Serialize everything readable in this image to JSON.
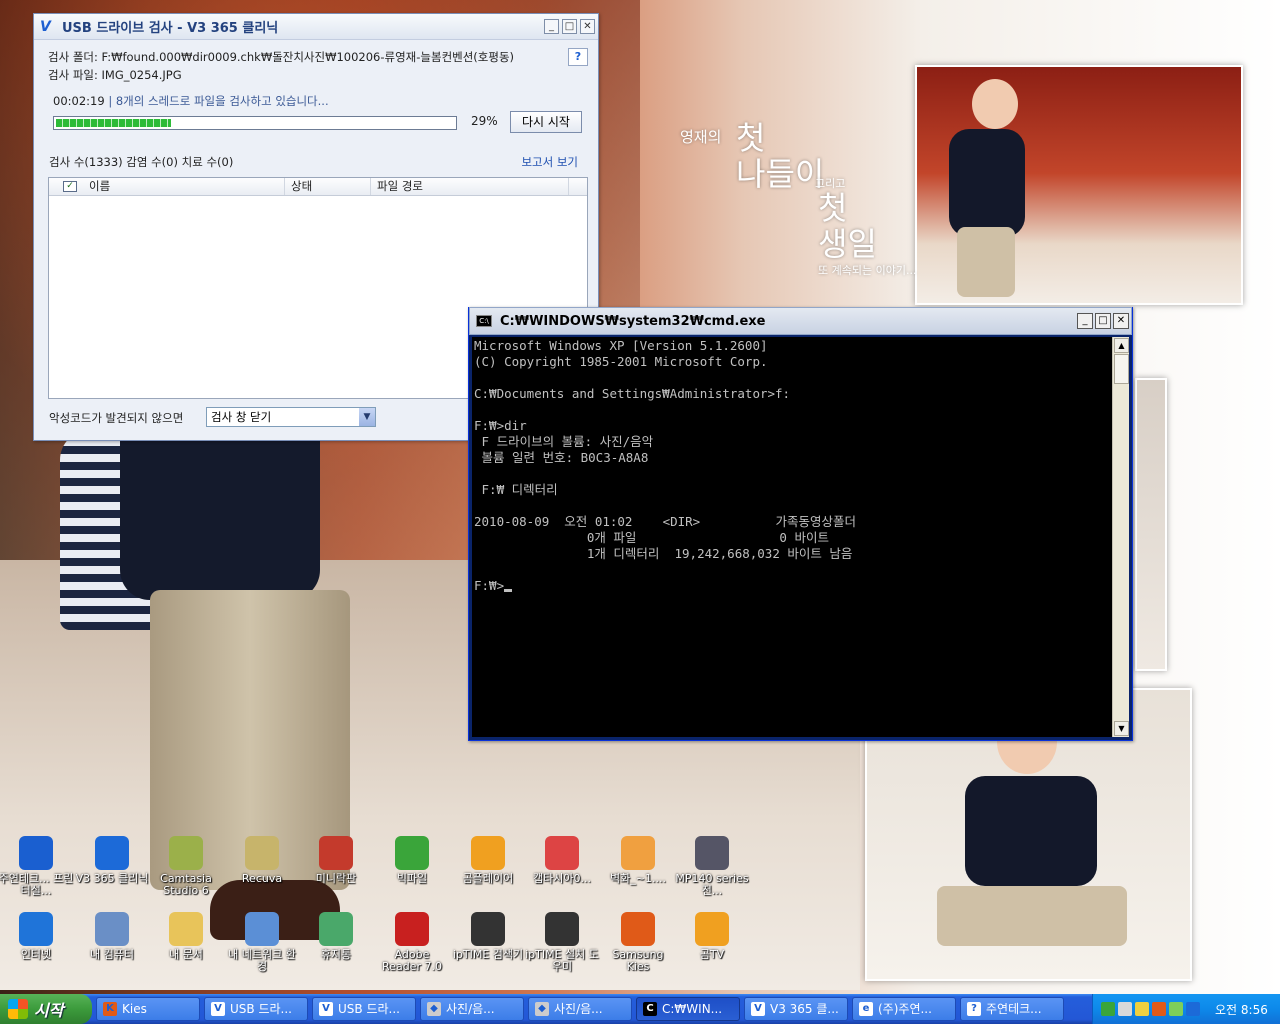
{
  "v3": {
    "title": "USB 드라이브 검사 - V3 365 클리닉",
    "folder_line": "검사 폴더: F:₩found.000₩dir0009.chk₩돌잔치사진₩100206-류영재-늘봄컨벤션(호평동)",
    "file_line": "검사 파일: IMG_0254.JPG",
    "elapsed": "00:02:19",
    "separator": "|",
    "status": "8개의 스레드로 파일을 검사하고 있습니다...",
    "progress": 0.29,
    "percent_label": "29%",
    "restart_label": "다시 시작",
    "counts": "검사 수(1333)  감염 수(0)  치료 수(0)",
    "report_link": "보고서 보기",
    "col_name": "이름",
    "col_status": "상태",
    "col_path": "파일 경로",
    "bottom_label": "악성코드가 발견되지 않으면",
    "select_value": "검사 창 닫기",
    "help": "?"
  },
  "cmd": {
    "title": "C:₩WINDOWS₩system32₩cmd.exe",
    "lines": [
      "Microsoft Windows XP [Version 5.1.2600]",
      "(C) Copyright 1985-2001 Microsoft Corp.",
      "",
      "C:₩Documents and Settings₩Administrator>f:",
      "",
      "F:₩>dir",
      " F 드라이브의 볼륨: 사진/음악",
      " 볼륨 일련 번호: B0C3-A8A8",
      "",
      " F:₩ 디렉터리",
      "",
      "2010-08-09  오전 01:02    <DIR>          가족동영상폴더",
      "               0개 파일                   0 바이트",
      "               1개 디렉터리  19,242,668,032 바이트 남음",
      "",
      "F:₩>"
    ]
  },
  "poem": {
    "l1": "영재의",
    "l2": "첫",
    "l3": "나들이",
    "l4": "그리고",
    "l5": "첫",
    "l6": "생일",
    "l7": "또 계속되는 이야기..."
  },
  "desktop_icons": [
    {
      "label": "주연테크... 프린터설...",
      "icon": "help-icon",
      "color": "#1a5fd0"
    },
    {
      "label": "V3 365 클리닉",
      "icon": "v3-icon",
      "color": "#1c6ad8"
    },
    {
      "label": "Camtasia Studio 6",
      "icon": "camtasia-icon",
      "color": "#9bb04a"
    },
    {
      "label": "Recuva",
      "icon": "recuva-icon",
      "color": "#c7b46b"
    },
    {
      "label": "미니락판",
      "icon": "minirak-icon",
      "color": "#c43a2c"
    },
    {
      "label": "빅파일",
      "icon": "bigfile-icon",
      "color": "#3aa53a"
    },
    {
      "label": "곰플레이어",
      "icon": "gomplayer-icon",
      "color": "#f0a020"
    },
    {
      "label": "캡타시아0...",
      "icon": "pdf-icon",
      "color": "#d44"
    },
    {
      "label": "벽화_~1....",
      "icon": "image-file-icon",
      "color": "#f0a040"
    },
    {
      "label": "MP140 series 전...",
      "icon": "printer-icon",
      "color": "#556"
    },
    {
      "label": "인터넷",
      "icon": "ie-icon",
      "color": "#1f74d9"
    },
    {
      "label": "내 컴퓨터",
      "icon": "my-computer-icon",
      "color": "#6a8fc6"
    },
    {
      "label": "내 문서",
      "icon": "my-documents-icon",
      "color": "#e8c45a"
    },
    {
      "label": "내 네트워크 환경",
      "icon": "network-icon",
      "color": "#5b8fd6"
    },
    {
      "label": "휴지통",
      "icon": "recycle-bin-icon",
      "color": "#4aa86a"
    },
    {
      "label": "Adobe Reader 7.0",
      "icon": "adobe-reader-icon",
      "color": "#c8201f"
    },
    {
      "label": "ipTIME 검색기",
      "icon": "iptime-icon",
      "color": "#333"
    },
    {
      "label": "ipTIME 설치 도우미",
      "icon": "iptime-setup-icon",
      "color": "#333"
    },
    {
      "label": "Samsung Kies",
      "icon": "kies-icon",
      "color": "#e05a18"
    },
    {
      "label": "곰TV",
      "icon": "gomtv-icon",
      "color": "#f0a020"
    }
  ],
  "taskbar": {
    "start_label": "시작",
    "tasks": [
      {
        "label": "Kies",
        "icon": "kies-icon",
        "color": "#e05a18",
        "glyph": "K"
      },
      {
        "label": "USB 드라...",
        "icon": "v3-icon",
        "color": "#fff",
        "glyph": "V"
      },
      {
        "label": "USB 드라...",
        "icon": "v3-icon",
        "color": "#fff",
        "glyph": "V"
      },
      {
        "label": "사진/음...",
        "icon": "drive-icon",
        "color": "#ccc",
        "glyph": "◆"
      },
      {
        "label": "사진/음...",
        "icon": "drive-icon",
        "color": "#ccc",
        "glyph": "◆"
      },
      {
        "label": "C:₩WIN...",
        "icon": "cmd-icon",
        "color": "#000",
        "glyph": "C"
      },
      {
        "label": "V3 365 클...",
        "icon": "v3-icon",
        "color": "#fff",
        "glyph": "V"
      },
      {
        "label": "(주)주연...",
        "icon": "ie-icon",
        "color": "#fff",
        "glyph": "e"
      },
      {
        "label": "주연테크...",
        "icon": "help-icon",
        "color": "#fff",
        "glyph": "?"
      }
    ],
    "clock": "오전 8:56"
  }
}
